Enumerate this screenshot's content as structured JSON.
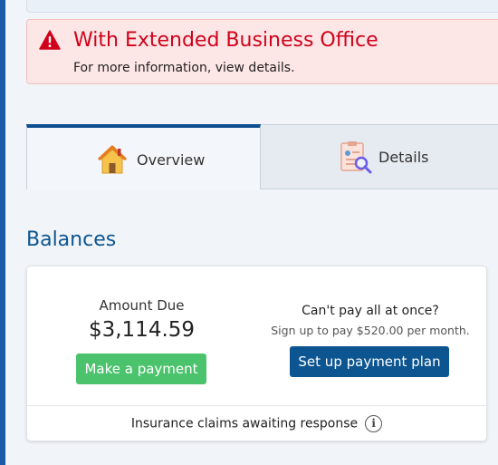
{
  "alert": {
    "icon": "warning-triangle-icon",
    "title": "With Extended Business Office",
    "subtitle": "For more information, view details.",
    "color": "#d0021b"
  },
  "tabs": [
    {
      "label": "Overview",
      "icon": "house-icon",
      "active": true
    },
    {
      "label": "Details",
      "icon": "document-search-icon",
      "active": false
    }
  ],
  "balances": {
    "title": "Balances",
    "amount_label": "Amount Due",
    "amount_value": "$3,114.59",
    "pay_button": "Make a payment",
    "cant_pay": "Can't pay all at once?",
    "signup": "Sign up to pay $520.00 per month.",
    "plan_button": "Set up payment plan",
    "insurance": "Insurance claims awaiting response",
    "info_icon": "info-icon"
  },
  "colors": {
    "primary": "#0d5591",
    "success": "#4bc36c",
    "alert_bg": "#fde6e6"
  }
}
